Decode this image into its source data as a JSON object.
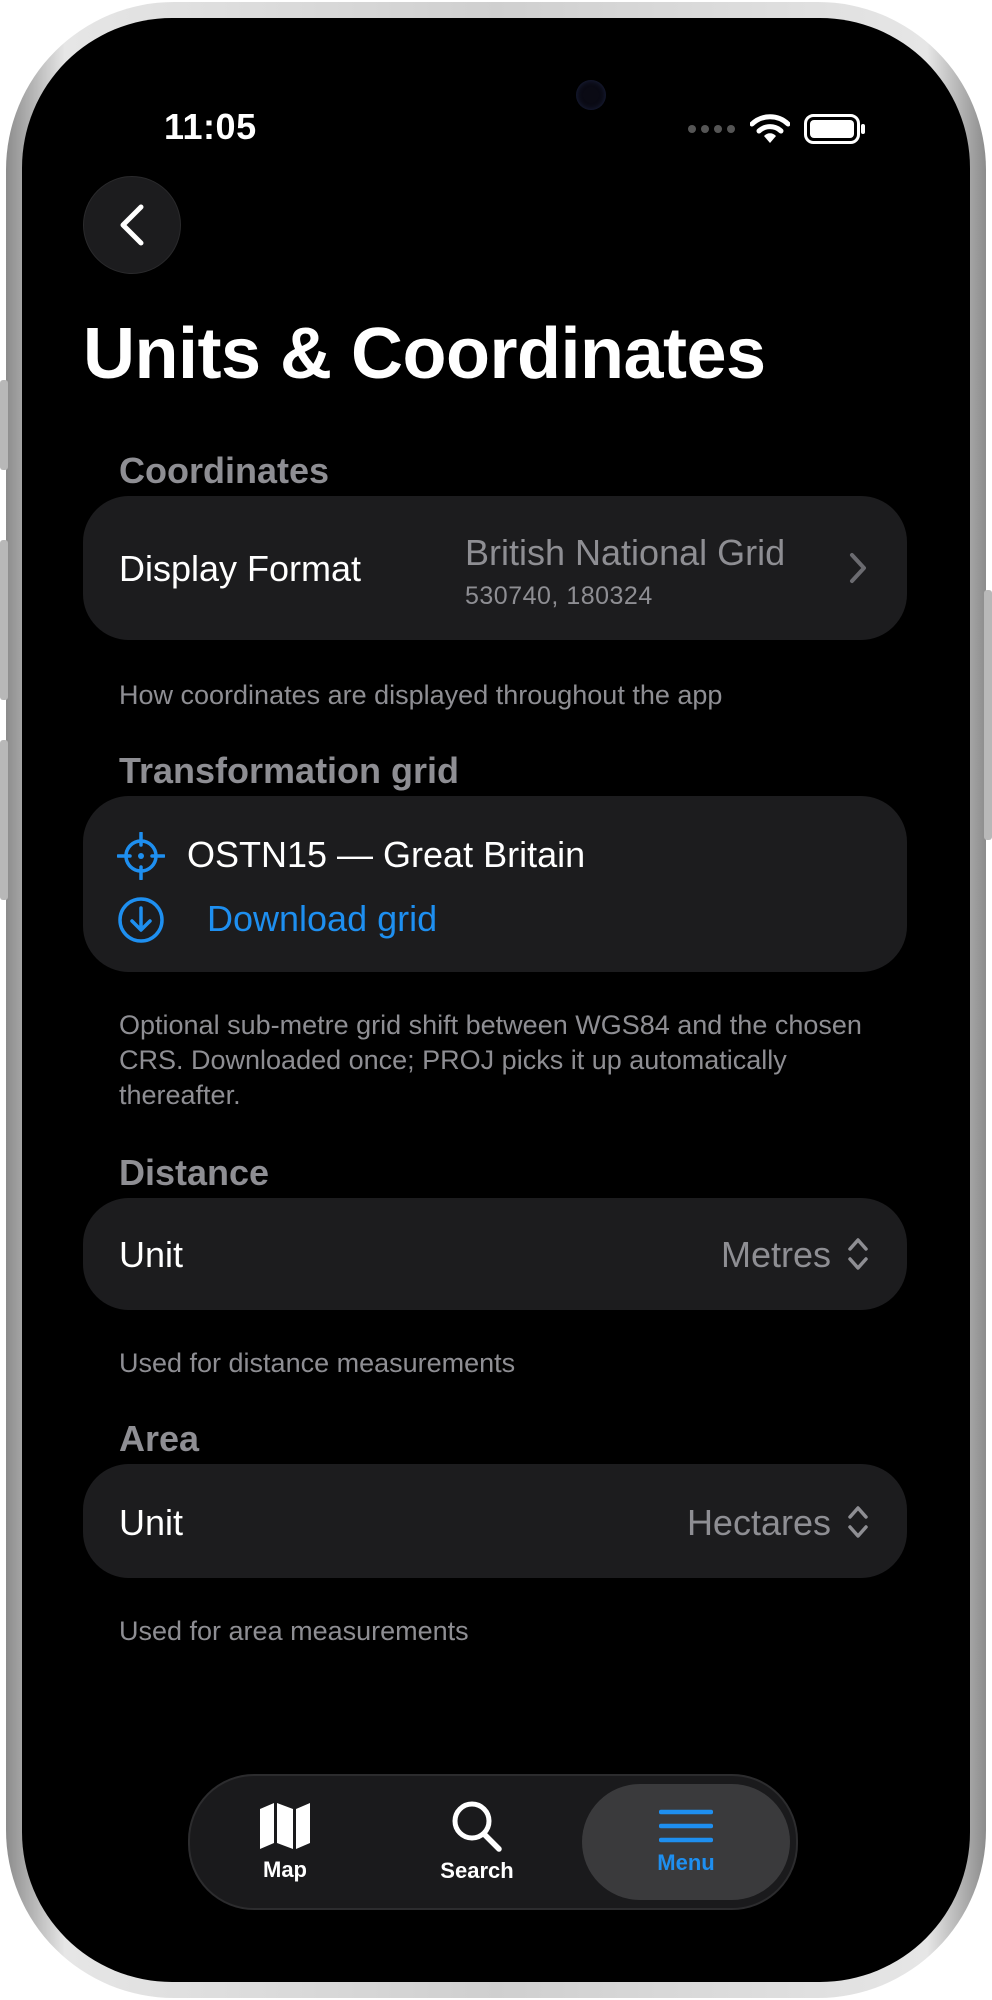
{
  "status": {
    "time": "11:05"
  },
  "header": {
    "title": "Units & Coordinates"
  },
  "sections": {
    "coordinates": {
      "heading": "Coordinates",
      "row_label": "Display Format",
      "value": "British National Grid",
      "sub_value": "530740, 180324",
      "footnote": "How coordinates are displayed throughout the app"
    },
    "transformation": {
      "heading": "Transformation grid",
      "grid_name": "OSTN15 — Great Britain",
      "download_label": "Download grid",
      "footnote": "Optional sub-metre grid shift between WGS84 and the chosen CRS. Downloaded once; PROJ picks it up automatically thereafter."
    },
    "distance": {
      "heading": "Distance",
      "row_label": "Unit",
      "value": "Metres",
      "footnote": "Used for distance measurements"
    },
    "area": {
      "heading": "Area",
      "row_label": "Unit",
      "value": "Hectares",
      "footnote": "Used for area measurements"
    }
  },
  "tabbar": {
    "tabs": [
      {
        "label": "Map",
        "icon": "map-icon"
      },
      {
        "label": "Search",
        "icon": "search-icon"
      },
      {
        "label": "Menu",
        "icon": "menu-icon",
        "active": true
      }
    ]
  },
  "colors": {
    "accent": "#1e8ff0",
    "card": "#1c1c1e",
    "secondary_text": "#8e8e93"
  }
}
